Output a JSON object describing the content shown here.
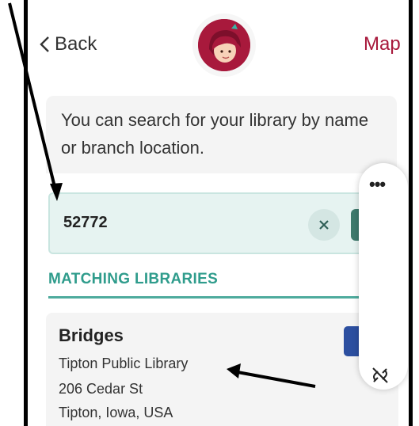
{
  "header": {
    "back_label": "Back",
    "map_label": "Map",
    "logo_icon": "libby-logo-icon"
  },
  "intro": {
    "text": "You can search for your library by name or branch location."
  },
  "search": {
    "value": "52772",
    "clear_icon": "close-icon"
  },
  "results": {
    "section_title": "MATCHING LIBRARIES",
    "items": [
      {
        "name": "Bridges",
        "library": "Tipton Public Library",
        "address": "206 Cedar St",
        "city": "Tipton, Iowa, USA"
      }
    ]
  },
  "floating_panel": {
    "more_glyph": "•••",
    "unlink_icon": "unlink-icon"
  },
  "colors": {
    "brand": "#a8193c",
    "teal": "#2f9c8c",
    "search_bg": "#e6f3f1",
    "card_bg": "#f4f4f4"
  }
}
